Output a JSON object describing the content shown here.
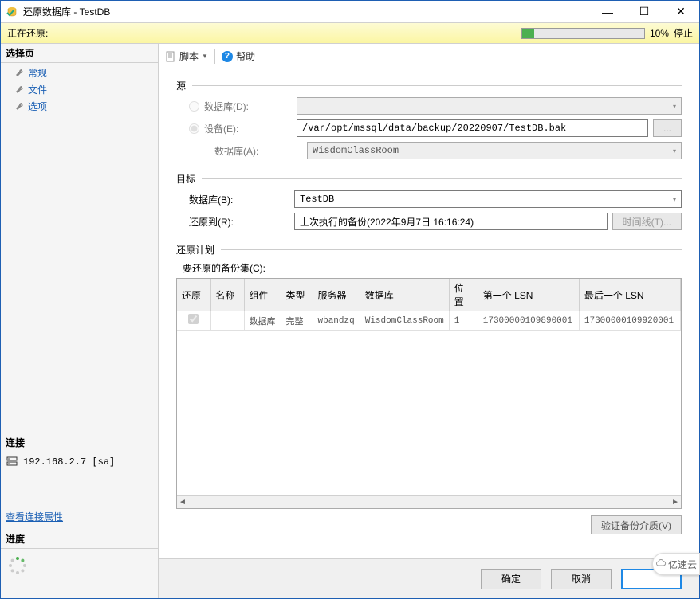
{
  "window": {
    "title": "还原数据库 - TestDB",
    "minimize": "—",
    "maximize": "☐",
    "close": "✕"
  },
  "progress": {
    "label": "正在还原:",
    "percent": "10%",
    "stop": "停止"
  },
  "sidebar": {
    "select_page": "选择页",
    "items": [
      {
        "label": "常规"
      },
      {
        "label": "文件"
      },
      {
        "label": "选项"
      }
    ],
    "connection": "连接",
    "conn_string": "192.168.2.7 [sa]",
    "view_conn": "查看连接属性",
    "progress_header": "进度"
  },
  "toolbar": {
    "script": "脚本",
    "help": "帮助"
  },
  "source": {
    "title": "源",
    "db_radio": "数据库(D):",
    "device_radio": "设备(E):",
    "device_path": "/var/opt/mssql/data/backup/20220907/TestDB.bak",
    "browse": "...",
    "db_label": "数据库(A):",
    "db_value": "WisdomClassRoom"
  },
  "target": {
    "title": "目标",
    "db_label": "数据库(B):",
    "db_value": "TestDB",
    "restore_to_label": "还原到(R):",
    "restore_to_value": "上次执行的备份(2022年9月7日 16:16:24)",
    "timeline_btn": "时间线(T)..."
  },
  "plan": {
    "title": "还原计划",
    "backup_sets_label": "要还原的备份集(C):",
    "headers": {
      "restore": "还原",
      "name": "名称",
      "component": "组件",
      "type": "类型",
      "server": "服务器",
      "database": "数据库",
      "position": "位置",
      "first_lsn": "第一个 LSN",
      "last_lsn": "最后一个 LSN"
    },
    "rows": [
      {
        "restore": true,
        "name": "",
        "component": "数据库",
        "type": "完整",
        "server": "wbandzq",
        "database": "WisdomClassRoom",
        "position": "1",
        "first_lsn": "17300000109890001",
        "last_lsn": "17300000109920001"
      }
    ],
    "verify_btn": "验证备份介质(V)"
  },
  "buttons": {
    "ok": "确定",
    "cancel": "取消"
  },
  "watermark": "亿速云"
}
